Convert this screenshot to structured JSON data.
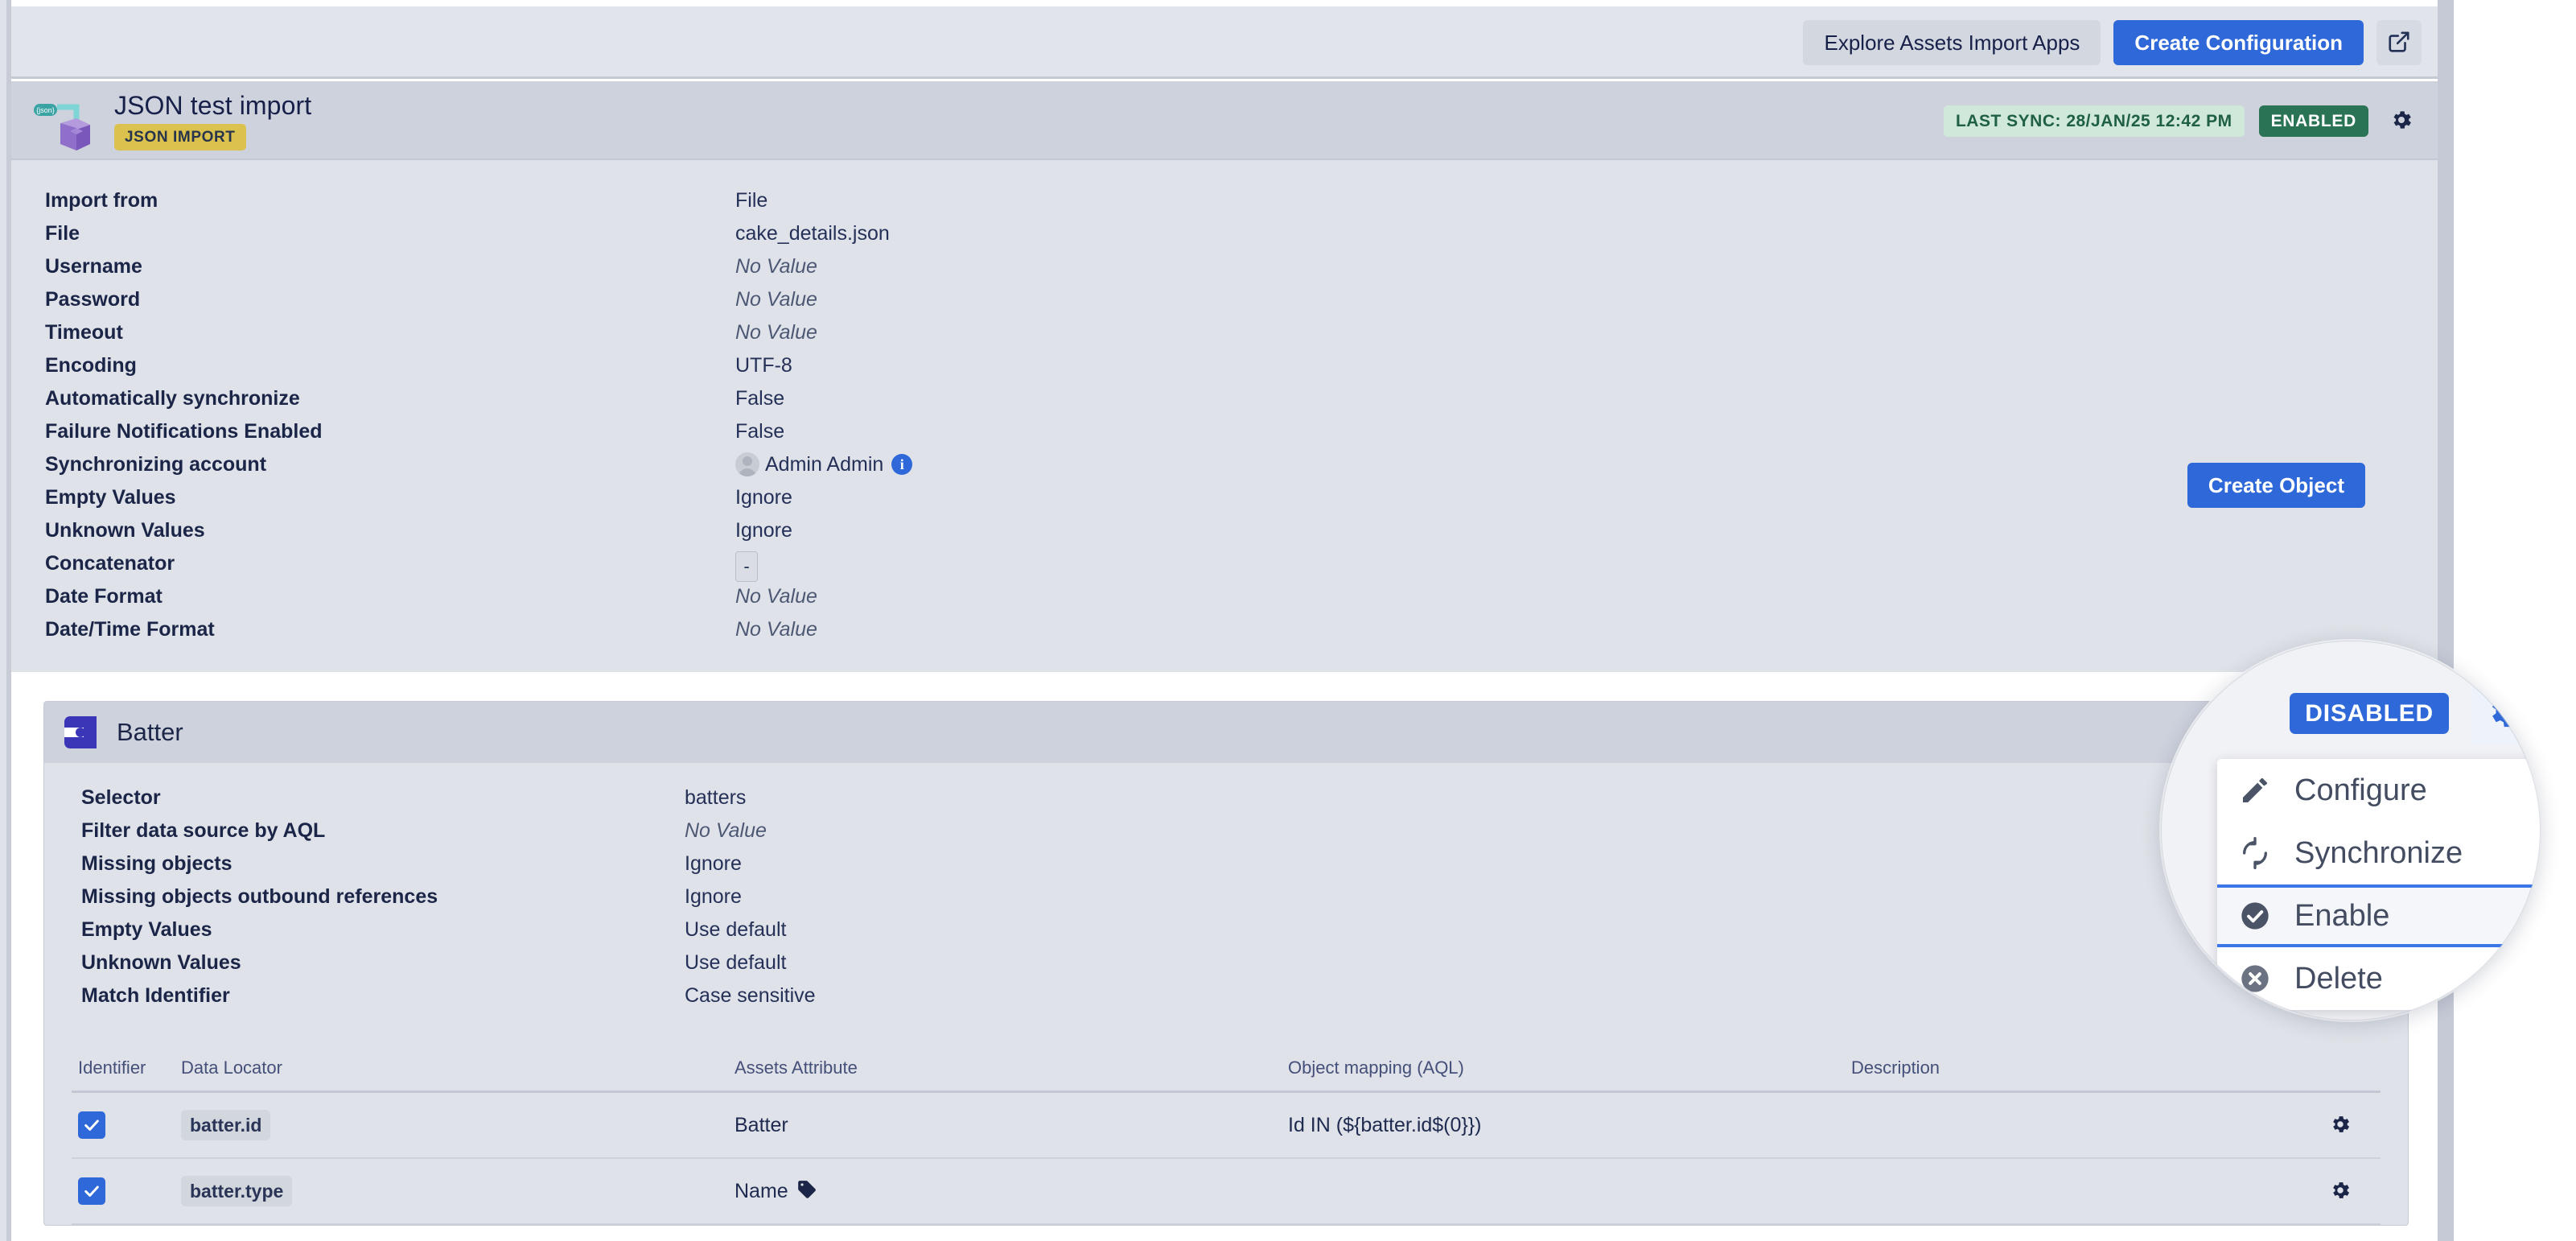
{
  "topbar": {
    "explore_label": "Explore Assets Import Apps",
    "create_config_label": "Create Configuration",
    "open_new_window_icon": "external-link-icon"
  },
  "config_header": {
    "title": "JSON test import",
    "type_badge": "JSON IMPORT",
    "last_sync": "LAST SYNC: 28/JAN/25 12:42 PM",
    "status_badge": "ENABLED",
    "gear_icon": "gear-icon",
    "json_icon_label": "{json}"
  },
  "details": {
    "rows": [
      {
        "key": "Import from",
        "value": "File",
        "style": "plain"
      },
      {
        "key": "File",
        "value": "cake_details.json",
        "style": "plain"
      },
      {
        "key": "Username",
        "value": "No Value",
        "style": "novalue"
      },
      {
        "key": "Password",
        "value": "No Value",
        "style": "novalue"
      },
      {
        "key": "Timeout",
        "value": "No Value",
        "style": "novalue"
      },
      {
        "key": "Encoding",
        "value": "UTF-8",
        "style": "plain"
      },
      {
        "key": "Automatically synchronize",
        "value": "False",
        "style": "plain"
      },
      {
        "key": "Failure Notifications Enabled",
        "value": "False",
        "style": "plain"
      },
      {
        "key": "Synchronizing account",
        "value": "Admin Admin",
        "style": "account"
      },
      {
        "key": "Empty Values",
        "value": "Ignore",
        "style": "plain"
      },
      {
        "key": "Unknown Values",
        "value": "Ignore",
        "style": "plain"
      },
      {
        "key": "Concatenator",
        "value": "-",
        "style": "boxed"
      },
      {
        "key": "Date Format",
        "value": "No Value",
        "style": "novalue"
      },
      {
        "key": "Date/Time Format",
        "value": "No Value",
        "style": "novalue"
      }
    ],
    "create_object_label": "Create Object"
  },
  "object_type": {
    "name": "Batter",
    "icon": "object-type-icon",
    "rows": [
      {
        "key": "Selector",
        "value": "batters",
        "style": "plain"
      },
      {
        "key": "Filter data source by AQL",
        "value": "No Value",
        "style": "novalue"
      },
      {
        "key": "Missing objects",
        "value": "Ignore",
        "style": "plain"
      },
      {
        "key": "Missing objects outbound references",
        "value": "Ignore",
        "style": "plain"
      },
      {
        "key": "Empty Values",
        "value": "Use default",
        "style": "plain"
      },
      {
        "key": "Unknown Values",
        "value": "Use default",
        "style": "plain"
      },
      {
        "key": "Match Identifier",
        "value": "Case sensitive",
        "style": "plain"
      }
    ]
  },
  "mapping_table": {
    "columns": [
      "Identifier",
      "Data Locator",
      "Assets Attribute",
      "Object mapping (AQL)",
      "Description"
    ],
    "rows": [
      {
        "identifier_checked": true,
        "data_locator": "batter.id",
        "assets_attribute": "Batter",
        "attribute_has_tag": false,
        "object_mapping": "Id IN (${batter.id$(0}})",
        "description": "",
        "gear_icon": "gear-icon"
      },
      {
        "identifier_checked": true,
        "data_locator": "batter.type",
        "assets_attribute": "Name",
        "attribute_has_tag": true,
        "object_mapping": "",
        "description": "",
        "gear_icon": "gear-icon"
      }
    ]
  },
  "magnifier": {
    "status_badge": "DISABLED",
    "gear_icon": "gear-icon",
    "menu": [
      {
        "label": "Configure",
        "icon": "pencil-icon",
        "selected": false
      },
      {
        "label": "Synchronize",
        "icon": "refresh-icon",
        "selected": false
      },
      {
        "label": "Enable",
        "icon": "check-circle-icon",
        "selected": true
      },
      {
        "label": "Delete",
        "icon": "cross-circle-icon",
        "selected": false
      }
    ]
  },
  "colors": {
    "accent_blue": "#2f68d8",
    "enabled_green": "#2b7355",
    "json_badge_yellow": "#dbc14e",
    "page_bg": "#dfe2e8",
    "header_bg": "#ced2dd",
    "text_dark": "#1b2547"
  }
}
